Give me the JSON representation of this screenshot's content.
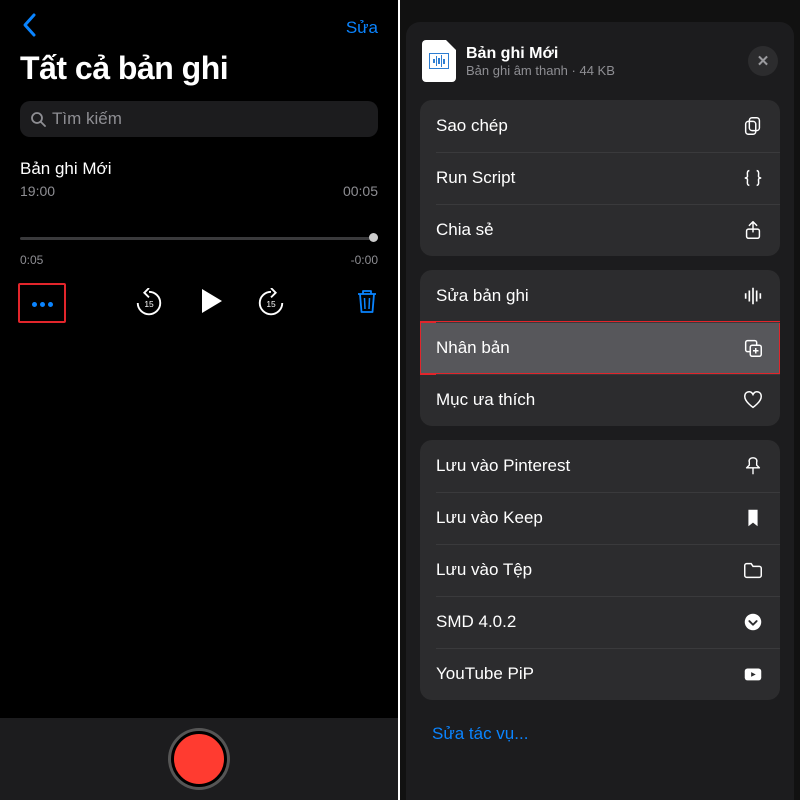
{
  "left": {
    "edit_label": "Sửa",
    "title": "Tất cả bản ghi",
    "search_placeholder": "Tìm kiếm",
    "recording": {
      "name": "Bản ghi Mới",
      "time": "19:00",
      "duration": "00:05"
    },
    "scrub": {
      "elapsed": "0:05",
      "remaining": "-0:00"
    },
    "skip_seconds": "15"
  },
  "right": {
    "header": {
      "title": "Bản ghi Mới",
      "subtitle": "Bản ghi âm thanh · 44 KB"
    },
    "group1": [
      {
        "label": "Sao chép",
        "icon": "copy"
      },
      {
        "label": "Run Script",
        "icon": "braces"
      },
      {
        "label": "Chia sẻ",
        "icon": "share"
      }
    ],
    "group2": [
      {
        "label": "Sửa bản ghi",
        "icon": "waveform"
      },
      {
        "label": "Nhân bản",
        "icon": "duplicate",
        "highlighted": true
      },
      {
        "label": "Mục ưa thích",
        "icon": "heart"
      }
    ],
    "group3": [
      {
        "label": "Lưu vào Pinterest",
        "icon": "pin"
      },
      {
        "label": "Lưu vào Keep",
        "icon": "bookmark"
      },
      {
        "label": "Lưu vào Tệp",
        "icon": "folder"
      },
      {
        "label": "SMD 4.0.2",
        "icon": "circle-down"
      },
      {
        "label": "YouTube PiP",
        "icon": "youtube"
      }
    ],
    "footer": "Sửa tác vụ..."
  }
}
